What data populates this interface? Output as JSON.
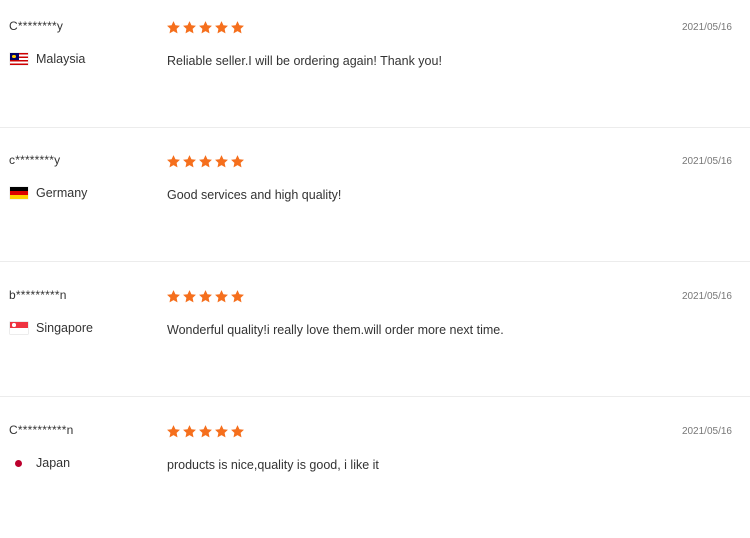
{
  "theme": {
    "star_color": "#f56f1d",
    "text_color": "#333333",
    "date_color": "#777777",
    "divider_color": "#ececec"
  },
  "reviews": [
    {
      "username": "C********y",
      "country": "Malaysia",
      "flag_icon": "malaysia-flag-icon",
      "rating": 5,
      "comment": "Reliable seller.I will be ordering again! Thank you!",
      "date": "2021/05/16"
    },
    {
      "username": "c********y",
      "country": "Germany",
      "flag_icon": "germany-flag-icon",
      "rating": 5,
      "comment": "Good services and high quality!",
      "date": "2021/05/16"
    },
    {
      "username": "b*********n",
      "country": "Singapore",
      "flag_icon": "singapore-flag-icon",
      "rating": 5,
      "comment": "Wonderful quality!i really love them.will order more next time.",
      "date": "2021/05/16"
    },
    {
      "username": "C**********n",
      "country": "Japan",
      "flag_icon": "japan-flag-icon",
      "rating": 5,
      "comment": "products is nice,quality is good, i like it",
      "date": "2021/05/16"
    }
  ]
}
